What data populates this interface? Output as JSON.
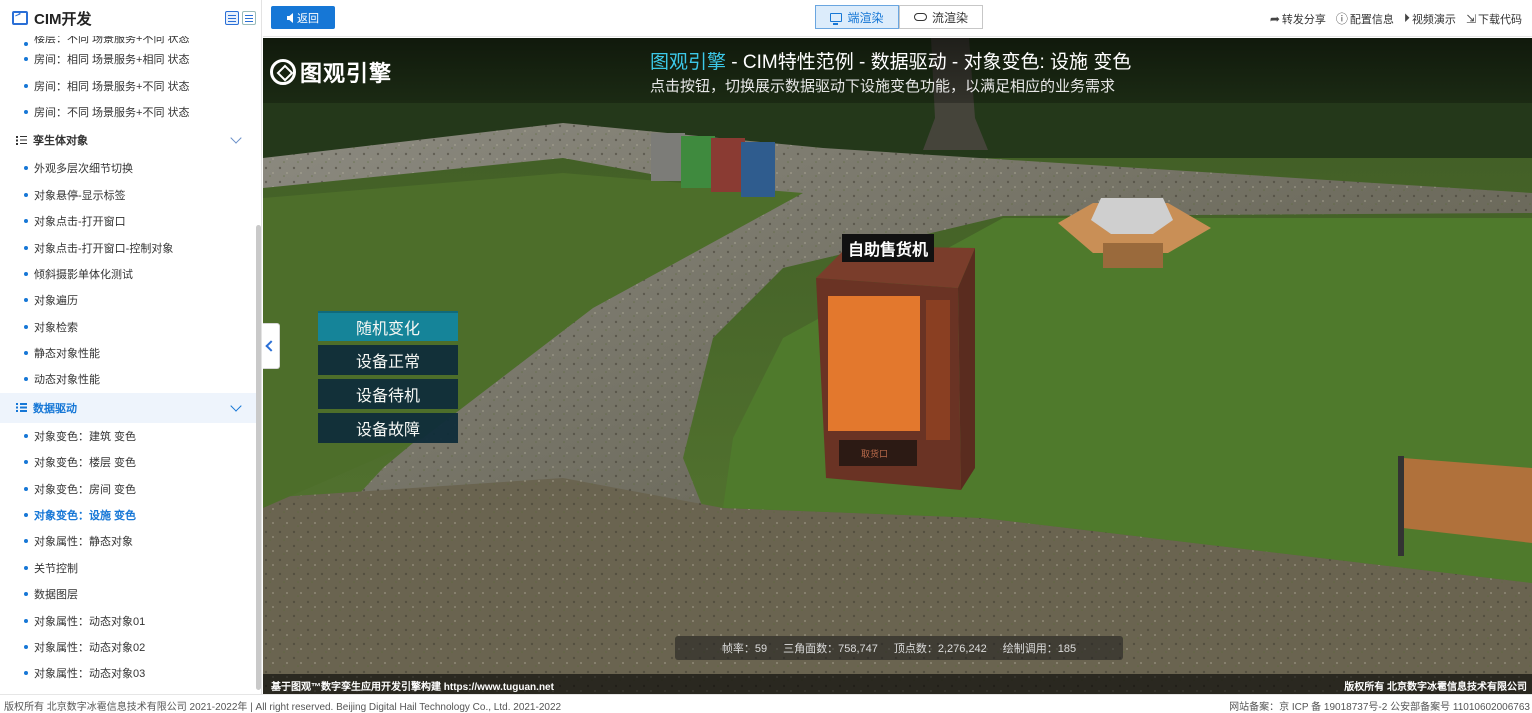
{
  "sidebar": {
    "title": "CIM开发",
    "items_top": [
      {
        "label": "楼层：不同 场景服务+不同 状态"
      },
      {
        "label": "房间：相同 场景服务+相同 状态"
      },
      {
        "label": "房间：相同 场景服务+不同 状态"
      },
      {
        "label": "房间：不同 场景服务+不同 状态"
      }
    ],
    "group_twin": {
      "label": "孪生体对象"
    },
    "items_twin": [
      {
        "label": "外观多层次细节切换"
      },
      {
        "label": "对象悬停-显示标签"
      },
      {
        "label": "对象点击-打开窗口"
      },
      {
        "label": "对象点击-打开窗口-控制对象"
      },
      {
        "label": "倾斜摄影单体化测试"
      },
      {
        "label": "对象遍历"
      },
      {
        "label": "对象检索"
      },
      {
        "label": "静态对象性能"
      },
      {
        "label": "动态对象性能"
      }
    ],
    "group_data": {
      "label": "数据驱动"
    },
    "items_data": [
      {
        "label": "对象变色：建筑 变色"
      },
      {
        "label": "对象变色：楼层 变色"
      },
      {
        "label": "对象变色：房间 变色"
      },
      {
        "label": "对象变色：设施 变色"
      },
      {
        "label": "对象属性：静态对象"
      },
      {
        "label": "关节控制"
      },
      {
        "label": "数据图层"
      },
      {
        "label": "对象属性：动态对象01"
      },
      {
        "label": "对象属性：动态对象02"
      },
      {
        "label": "对象属性：动态对象03"
      }
    ]
  },
  "topbar": {
    "back_label": "返回",
    "render_modes": [
      "端渲染",
      "流渲染"
    ],
    "actions": [
      "转发分享",
      "配置信息",
      "视频演示",
      "下载代码"
    ]
  },
  "viewport": {
    "brand": "图观引擎",
    "title_brand": "图观引擎",
    "title_rest": " - CIM特性范例 - 数据驱动 - 对象变色: 设施 变色",
    "subtitle": "点击按钮，切换展示数据驱动下设施变色功能，以满足相应的业务需求",
    "object_label": "自助售货机",
    "vending_slot": "取货口",
    "buttons": [
      "随机变化",
      "设备正常",
      "设备待机",
      "设备故障"
    ],
    "stats": {
      "fps": "帧率：59",
      "triangles": "三角面数：758,747",
      "vertices": "顶点数：2,276,242",
      "drawcalls": "绘制调用：185"
    },
    "left_note": "基于图观™数字孪生应用开发引擎构建 https://www.tuguan.net",
    "right_note": "版权所有 北京数字冰雹信息技术有限公司"
  },
  "footer": {
    "left": "版权所有 北京数字冰雹信息技术有限公司 2021-2022年 | All right reserved. Beijing Digital Hail Technology Co., Ltd. 2021-2022",
    "right": "网站备案：京 ICP 备 19018737号-2 公安部备案号 11010602006763"
  }
}
